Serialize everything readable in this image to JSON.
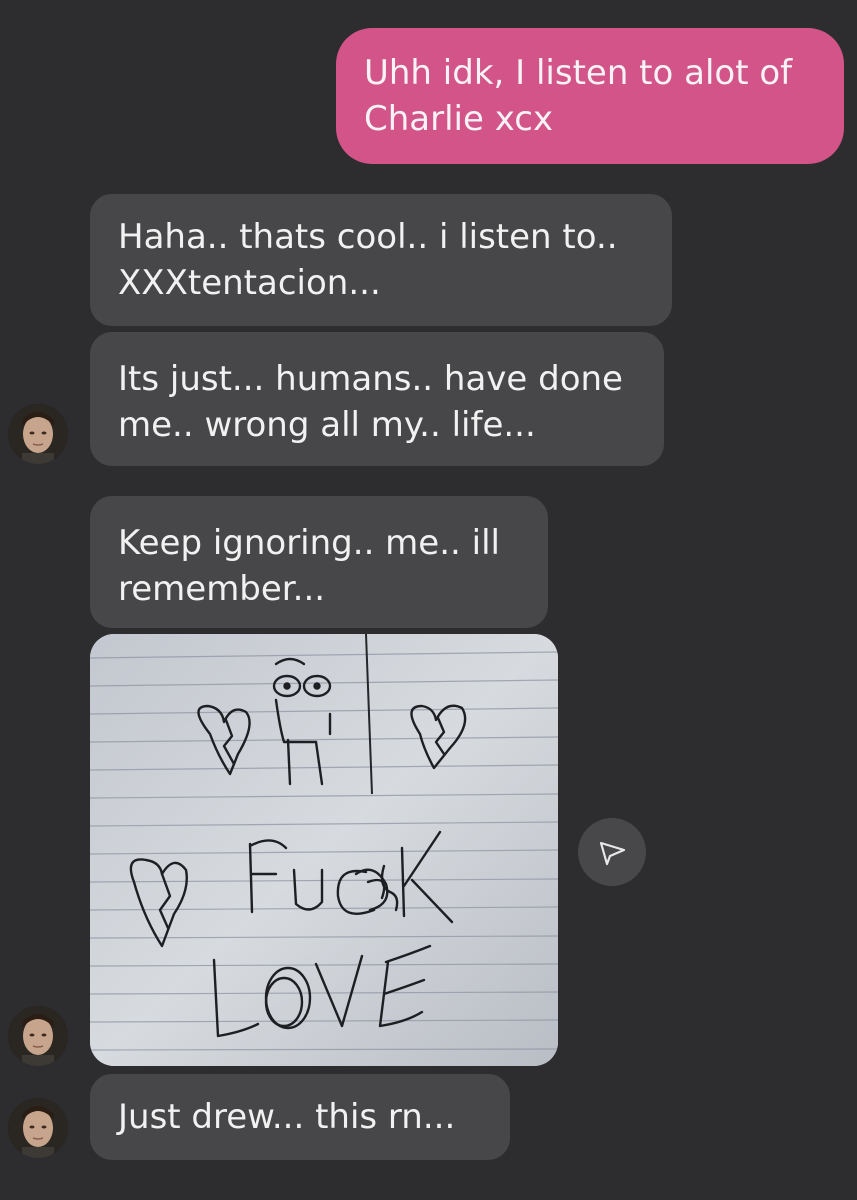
{
  "conversation": {
    "messages": [
      {
        "direction": "sent",
        "lines": [
          "Uhh idk, I listen to alot of",
          "Charlie xcx"
        ]
      },
      {
        "direction": "received",
        "lines": [
          "Haha.. thats cool.. i listen to..",
          "XXXtentacion..."
        ]
      },
      {
        "direction": "received",
        "lines": [
          "Its just... humans..  have done",
          "me.. wrong all my.. life..."
        ]
      },
      {
        "direction": "received",
        "lines": [
          "Keep ignoring.. me.. ill",
          "remember..."
        ]
      },
      {
        "direction": "received",
        "type": "image",
        "image": {
          "description_icon": "drawing-image",
          "handwritten_lines": [
            "FUCK",
            "LOVE"
          ]
        }
      },
      {
        "direction": "received",
        "lines": [
          "Just drew... this rn..."
        ]
      }
    ]
  },
  "icons": {
    "share": "send-icon",
    "avatar": "contact-avatar"
  },
  "colors": {
    "background": "#2d2d2f",
    "sent_bubble": "#d25488",
    "received_bubble": "#474749"
  }
}
